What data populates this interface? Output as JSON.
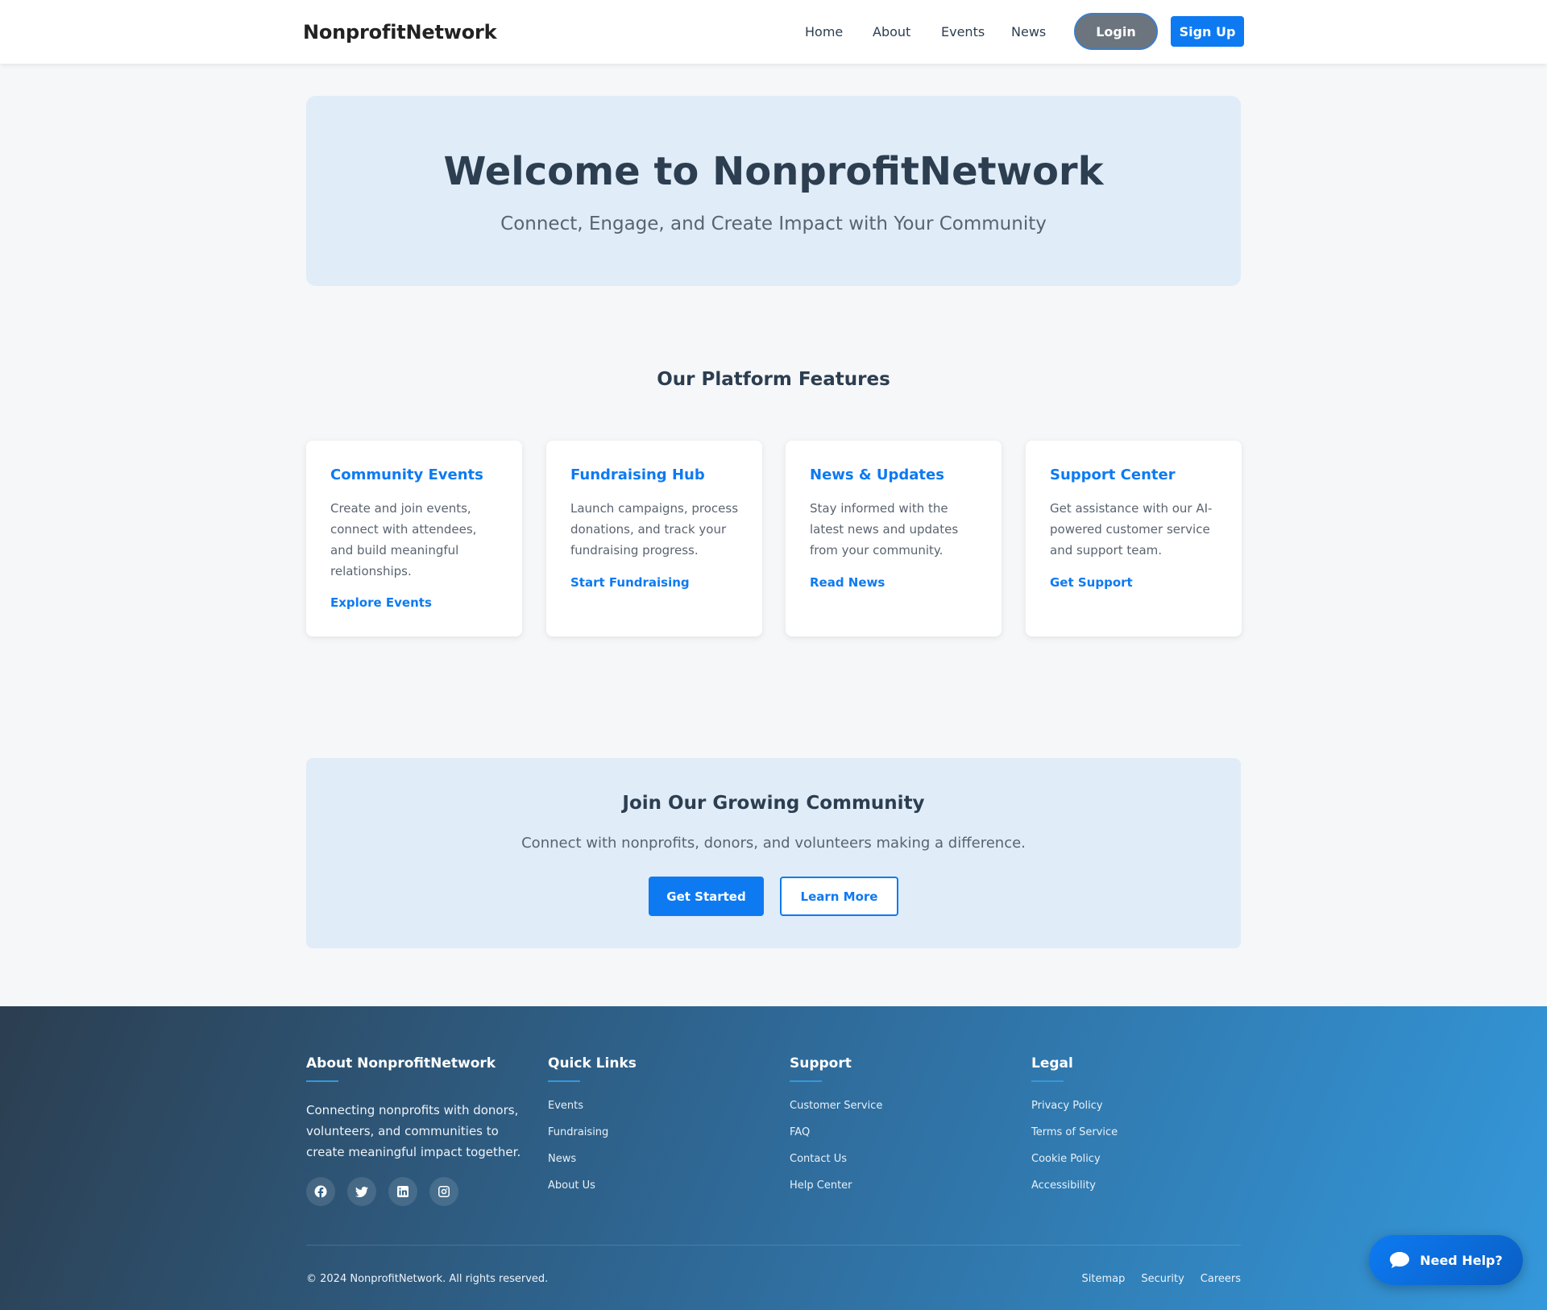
{
  "header": {
    "brand": "NonprofitNetwork",
    "nav": [
      "Home",
      "About",
      "Events",
      "News"
    ],
    "login": "Login",
    "signup": "Sign Up"
  },
  "hero": {
    "title": "Welcome to NonprofitNetwork",
    "subtitle": "Connect, Engage, and Create Impact with Your Community"
  },
  "features": {
    "title": "Our Platform Features",
    "cards": [
      {
        "title": "Community Events",
        "text": "Create and join events, connect with attendees, and build meaningful relationships.",
        "link": "Explore Events"
      },
      {
        "title": "Fundraising Hub",
        "text": "Launch campaigns, process donations, and track your fundraising progress.",
        "link": "Start Fundraising"
      },
      {
        "title": "News & Updates",
        "text": "Stay informed with the latest news and updates from your community.",
        "link": "Read News"
      },
      {
        "title": "Support Center",
        "text": "Get assistance with our AI-powered customer service and support team.",
        "link": "Get Support"
      }
    ]
  },
  "cta": {
    "title": "Join Our Growing Community",
    "text": "Connect with nonprofits, donors, and volunteers making a difference.",
    "primary": "Get Started",
    "secondary": "Learn More"
  },
  "footer": {
    "about": {
      "title": "About NonprofitNetwork",
      "text": "Connecting nonprofits with donors, volunteers, and communities to create meaningful impact together.",
      "socials": [
        "facebook-icon",
        "twitter-icon",
        "linkedin-icon",
        "instagram-icon"
      ]
    },
    "quick_links": {
      "title": "Quick Links",
      "items": [
        "Events",
        "Fundraising",
        "News",
        "About Us"
      ]
    },
    "support": {
      "title": "Support",
      "items": [
        "Customer Service",
        "FAQ",
        "Contact Us",
        "Help Center"
      ]
    },
    "legal": {
      "title": "Legal",
      "items": [
        "Privacy Policy",
        "Terms of Service",
        "Cookie Policy",
        "Accessibility"
      ]
    },
    "copyright": "© 2024 NonprofitNetwork. All rights reserved.",
    "bottom_links": [
      "Sitemap",
      "Security",
      "Careers"
    ]
  },
  "help_widget": {
    "label": "Need Help?",
    "icon": "chat-bubble-icon"
  },
  "colors": {
    "accent": "#0d7af2",
    "dark": "#2c3e50",
    "hero_bg": "#e0ecf8",
    "login_bg": "#6c757d"
  }
}
